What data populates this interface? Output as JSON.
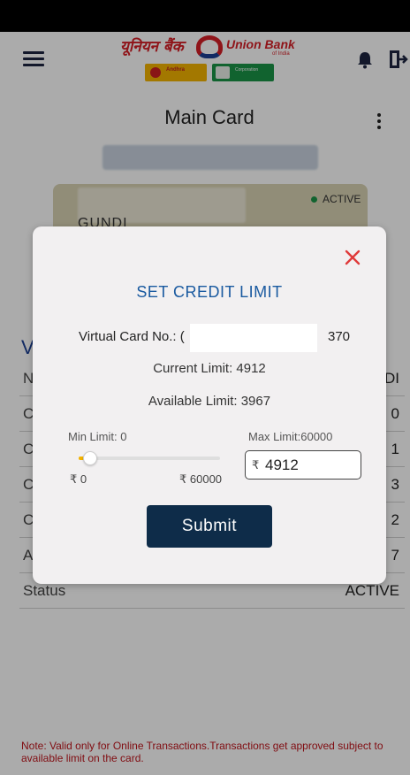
{
  "header": {
    "logo_hindi": "यूनियन बैंक",
    "logo_english": "Union Bank",
    "logo_english_sub": "of India",
    "logo_andhra": "Andhra",
    "logo_corporation": "Corporation"
  },
  "page": {
    "title": "Main Card"
  },
  "card": {
    "status": "ACTIVE",
    "name": "GUNDI"
  },
  "section": {
    "letter": "V"
  },
  "table": {
    "rows": [
      {
        "left": "N",
        "right": "DI"
      },
      {
        "left": "C",
        "right": "0"
      },
      {
        "left": "C",
        "right": "1"
      },
      {
        "left": "C",
        "right": "3"
      },
      {
        "left": "C",
        "right": "2"
      },
      {
        "left": "A",
        "right": "7"
      },
      {
        "left": "Status",
        "right": "ACTIVE"
      }
    ]
  },
  "note": "Note: Valid only for Online Transactions.Transactions get approved subject to available limit on the card.",
  "modal": {
    "title": "SET CREDIT LIMIT",
    "virtual_card_label": "Virtual Card No.: (",
    "virtual_card_suffix": "370",
    "current_limit": "Current Limit: 4912",
    "available_limit": "Available Limit: 3967",
    "min_limit_label": "Min Limit: 0",
    "max_limit_label": "Max Limit:60000",
    "scale_min": "₹ 0",
    "scale_max": "₹ 60000",
    "currency_symbol": "₹",
    "limit_value": "4912",
    "slider_fraction": 0.082,
    "submit_label": "Submit"
  },
  "colors": {
    "accent": "#0e2c49",
    "title_blue": "#1a5aa0",
    "slider_fill": "#f4b300",
    "close_red": "#e03a3a",
    "note_red": "#c0161d"
  },
  "icons": {
    "menu": "hamburger-icon",
    "notifications": "bell-icon",
    "logout": "exit-icon",
    "more": "more-vertical-icon",
    "close": "close-icon"
  }
}
